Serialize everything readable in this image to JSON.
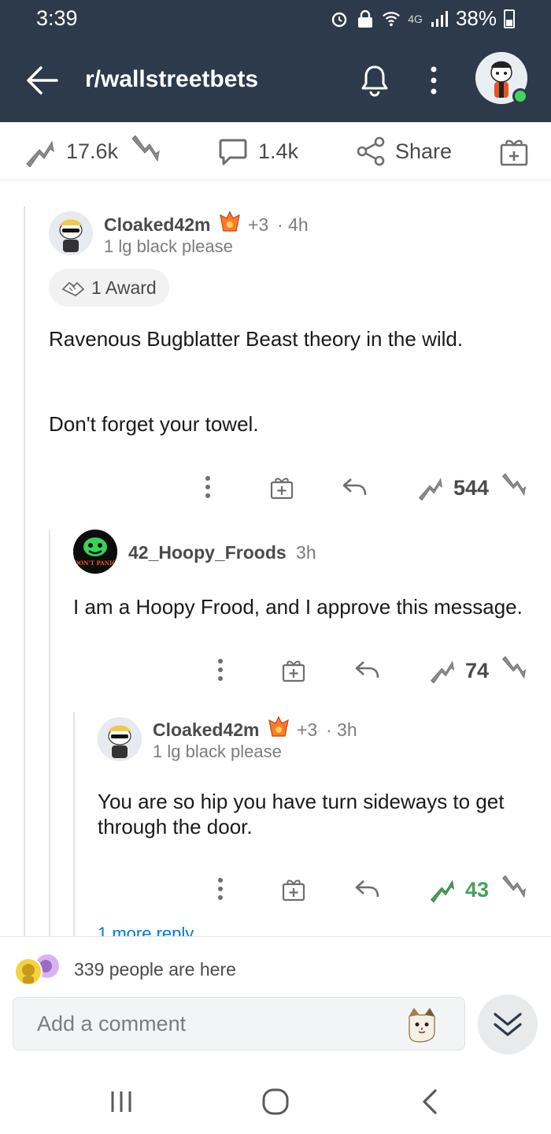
{
  "status_bar": {
    "time": "3:39",
    "network": "4G",
    "battery": "38%"
  },
  "app_bar": {
    "subreddit": "r/wallstreetbets"
  },
  "post_bar": {
    "score": "17.6k",
    "comments": "1.4k",
    "share_label": "Share"
  },
  "comments": [
    {
      "author": "Cloaked42m",
      "karma_badge": "+3",
      "time": "· 4h",
      "flair": "1 lg black please",
      "award_label": "1 Award",
      "body_line1": "Ravenous Bugblatter Beast theory in the wild.",
      "body_line2": "Don't forget your towel.",
      "score": "544"
    },
    {
      "author": "42_Hoopy_Froods",
      "time": "3h",
      "avatar_text": "DON'T PANIC",
      "body": "I am a Hoopy Frood, and I approve this message.",
      "score": "74"
    },
    {
      "author": "Cloaked42m",
      "karma_badge": "+3",
      "time": "· 3h",
      "flair": "1 lg black please",
      "body": "You are so hip you have turn sideways to get through the door.",
      "score": "43",
      "more_replies": "1 more reply"
    }
  ],
  "bottom": {
    "people_here": "339 people are here",
    "comment_placeholder": "Add a comment"
  },
  "colors": {
    "header": "#2d3a4b",
    "upvoted": "#46a05b",
    "link": "#0079d3"
  }
}
